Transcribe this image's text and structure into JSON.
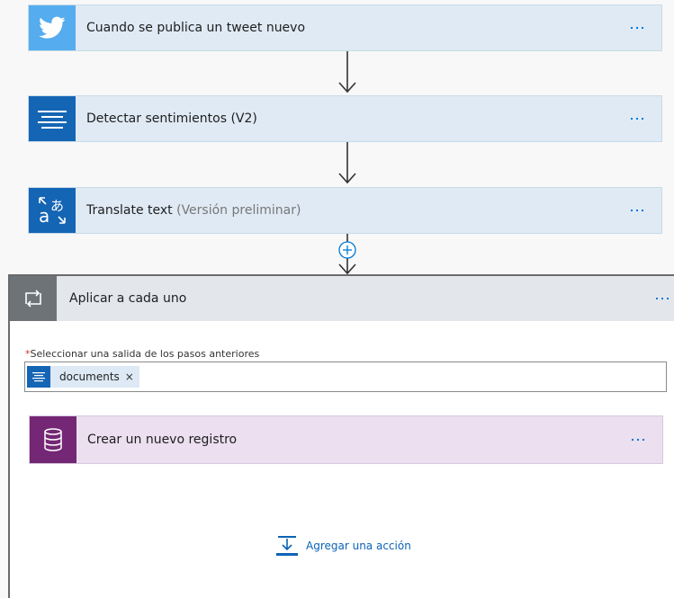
{
  "steps": [
    {
      "title": "Cuando se publica un tweet nuevo",
      "subtitle": "",
      "icon": "twitter-bird-icon",
      "color": "#55acee"
    },
    {
      "title": "Detectar sentimientos (V2)",
      "subtitle": "",
      "icon": "text-analytics-icon",
      "color": "#1565b5"
    },
    {
      "title": "Translate text",
      "subtitle": "(Versión preliminar)",
      "icon": "translator-icon",
      "color": "#1565b5"
    }
  ],
  "insert_step_icon": "plus-circle-icon",
  "loop": {
    "title": "Aplicar a cada uno",
    "icon": "loop-arrows-icon",
    "field": {
      "required_marker": "*",
      "label": "Seleccionar una salida de los pasos anteriores",
      "token": {
        "text": "documents",
        "remove": "×",
        "icon": "text-analytics-icon"
      }
    },
    "inner_step": {
      "title": "Crear un nuevo registro",
      "icon": "database-icon",
      "color": "#742774"
    },
    "add_action": {
      "label": "Agregar una acción",
      "icon": "add-action-icon"
    }
  },
  "colors": {
    "accent": "#0078d4",
    "card_bg": "#dfeaf5",
    "loop_header_bg": "#e3e7ec",
    "inner_card_bg": "#ebdff0"
  }
}
